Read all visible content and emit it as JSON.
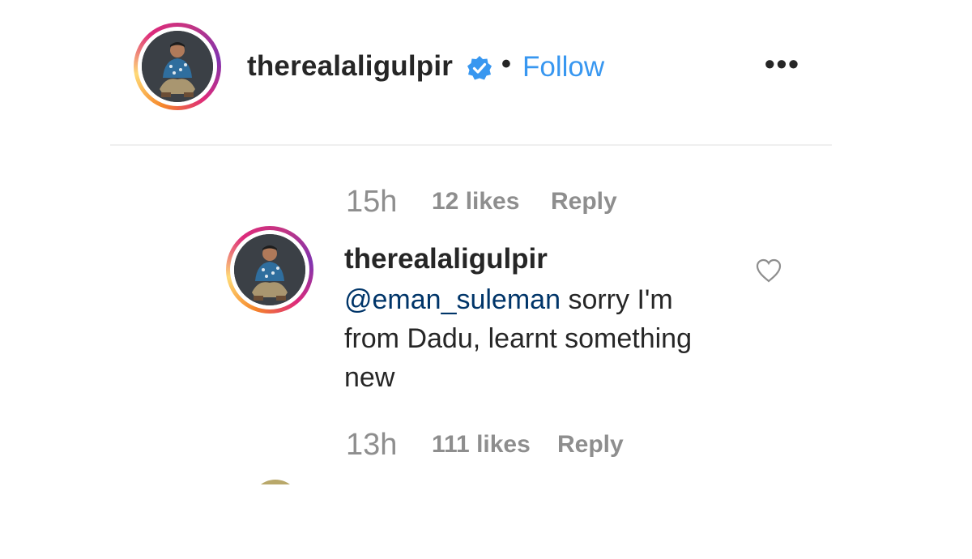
{
  "header": {
    "username": "therealaligulpir",
    "separator": "•",
    "follow_label": "Follow",
    "more_label": "•••",
    "verified_icon": "verified-badge-icon",
    "accent_color": "#3897f0"
  },
  "comments": [
    {
      "time": "15h",
      "likes": "12 likes",
      "reply_label": "Reply"
    },
    {
      "username": "therealaligulpir",
      "mention": "@eman_suleman",
      "text": " sorry I'm from Dadu, learnt something new",
      "time": "13h",
      "likes": "111 likes",
      "reply_label": "Reply",
      "like_icon": "heart-outline-icon"
    }
  ]
}
